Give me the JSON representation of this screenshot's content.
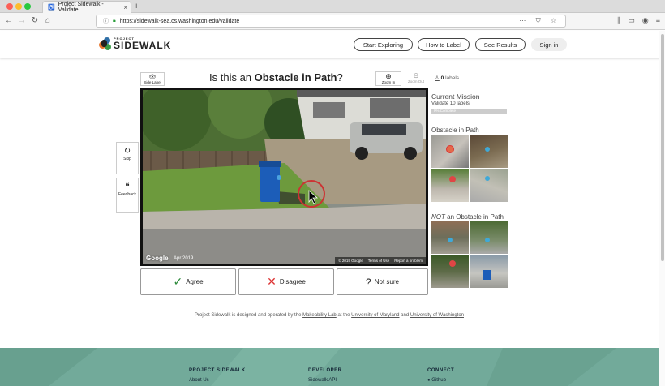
{
  "browser": {
    "tab_title": "Project Sidewalk - Validate",
    "url": "https://sidewalk-sea.cs.washington.edu/validate",
    "new_tab": "+",
    "tab_close": "×"
  },
  "header": {
    "logo_small": "PROJECT",
    "logo_big": "SIDEWALK",
    "nav": [
      "Start Exploring",
      "How to Label",
      "See Results"
    ],
    "sign_in": "Sign in"
  },
  "validate": {
    "side_label": "Side Label",
    "question_prefix": "Is this an ",
    "question_bold": "Obstacle in Path",
    "question_suffix": "?",
    "zoom_in": "Zoom In",
    "zoom_out": "Zoom Out",
    "count_value": "0",
    "count_label": " labels",
    "skip": "Skip",
    "feedback": "Feedback",
    "agree": "Agree",
    "disagree": "Disagree",
    "not_sure": "Not sure",
    "pano_google": "Google",
    "pano_date": "Apr 2019",
    "pano_copyright": "© 2019 Google",
    "pano_terms": "Terms of Use",
    "pano_report": "Report a problem"
  },
  "mission": {
    "title": "Current Mission",
    "subtitle": "Validate 10 labels",
    "progress": 0,
    "progress_text": "0% Complete"
  },
  "examples": {
    "positive_title": "Obstacle in Path",
    "negative_prefix": "NOT",
    "negative_title": " an Obstacle in Path"
  },
  "credit": {
    "text1": "Project Sidewalk is designed and operated by the ",
    "link1": "Makeability Lab",
    "text2": " at the ",
    "link2": "University of Maryland",
    "text3": " and ",
    "link3": "University of Washington"
  },
  "footer": {
    "col1_title": "PROJECT SIDEWALK",
    "col1_link": "About Us",
    "col2_title": "DEVELOPER",
    "col2_link": "Sidewalk API",
    "col3_title": "CONNECT",
    "col3_link": "Github"
  },
  "colors": {
    "footer_bg": "#72aa9a",
    "agree_check": "#2e8b3c",
    "disagree_cross": "#dd3333"
  }
}
